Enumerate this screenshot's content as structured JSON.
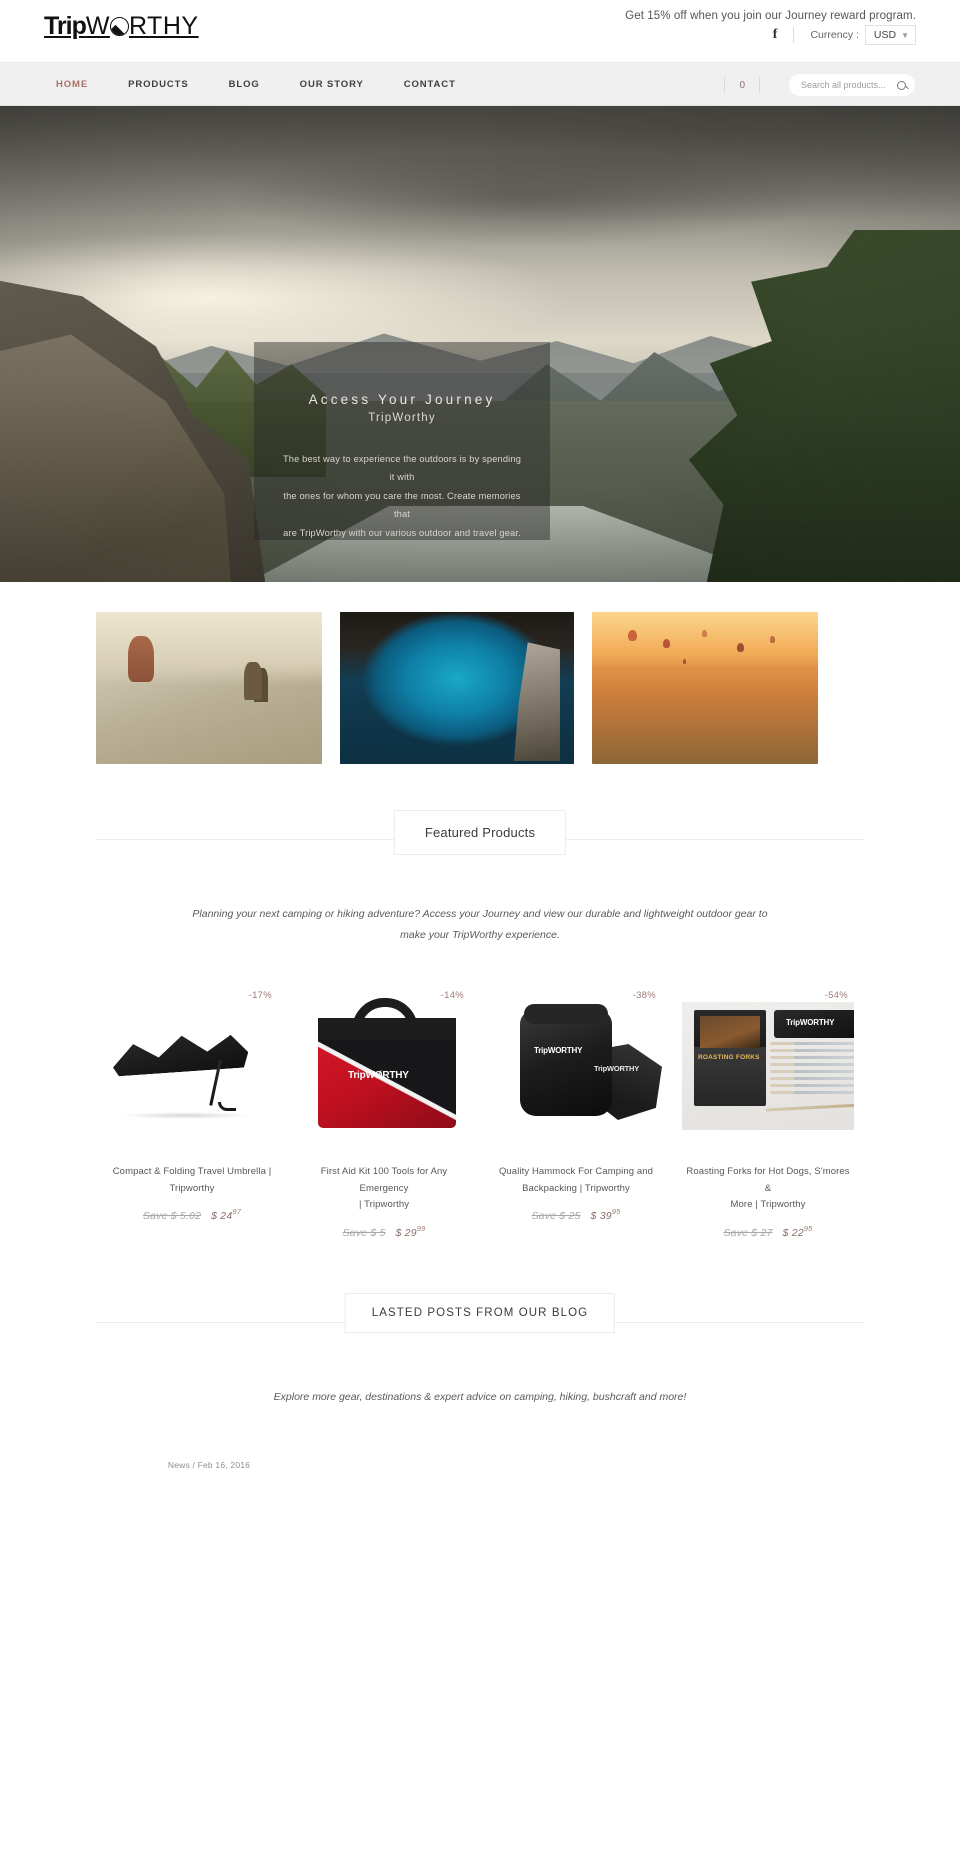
{
  "header": {
    "logo": {
      "part1": "Trip",
      "part2_pre": "W",
      "part2_post": "RTHY",
      "alt": "TripWorthy"
    },
    "promo_text": "Get 15% off when you join our Journey reward program.",
    "facebook_glyph": "f",
    "currency_label": "Currency :",
    "currency_value": "USD"
  },
  "nav": {
    "items": [
      {
        "label": "HOME",
        "active": true
      },
      {
        "label": "PRODUCTS",
        "active": false
      },
      {
        "label": "BLOG",
        "active": false
      },
      {
        "label": "OUR STORY",
        "active": false
      },
      {
        "label": "CONTACT",
        "active": false
      }
    ],
    "cart_count": "0",
    "search_placeholder": "Search all products...",
    "search_value": ""
  },
  "hero": {
    "title": "Access Your Journey",
    "subtitle": "TripWorthy",
    "body_line1": "The best way to experience the outdoors is by spending it with",
    "body_line2": "the ones for whom you care the most. Create memories that",
    "body_line3": "are TripWorthy with our various outdoor and travel gear."
  },
  "gallery": [
    {
      "caption": "deer-in-winter-field-photo"
    },
    {
      "caption": "sea-cave-turquoise-water-photo"
    },
    {
      "caption": "hot-air-balloons-cappadocia-photo"
    }
  ],
  "featured": {
    "heading": "Featured Products",
    "description_line1": "Planning your next camping or hiking adventure? Access your Journey and view our durable and lightweight outdoor gear to",
    "description_line2": "make your TripWorthy experience.",
    "products": [
      {
        "discount": "-17%",
        "title_line1": "Compact & Folding Travel Umbrella |",
        "title_line2": "Tripworthy",
        "save": "Save $ 5.02",
        "price_main": "$ 24",
        "price_cents": "97"
      },
      {
        "discount": "-14%",
        "title_line1": "First Aid Kit 100 Tools for Any Emergency",
        "title_line2": "| Tripworthy",
        "save": "Save $ 5",
        "price_main": "$ 29",
        "price_cents": "99",
        "brand": "TripWØRTHY"
      },
      {
        "discount": "-38%",
        "title_line1": "Quality Hammock For Camping and",
        "title_line2": "Backpacking | Tripworthy",
        "save": "Save $ 25",
        "price_main": "$ 39",
        "price_cents": "95",
        "brand": "TripWORTHY"
      },
      {
        "discount": "-54%",
        "title_line1": "Roasting Forks for Hot Dogs, S'mores &",
        "title_line2": "More | Tripworthy",
        "save": "Save $ 27",
        "price_main": "$ 22",
        "price_cents": "95",
        "brand": "TripWORTHY",
        "card_text": "ROASTING FORKS"
      }
    ]
  },
  "blog": {
    "heading": "LASTED POSTS FROM OUR BLOG",
    "description": "Explore more gear, destinations & expert advice on camping, hiking, bushcraft and more!",
    "posts": [
      {
        "meta": "News / Feb 16, 2016"
      }
    ]
  }
}
